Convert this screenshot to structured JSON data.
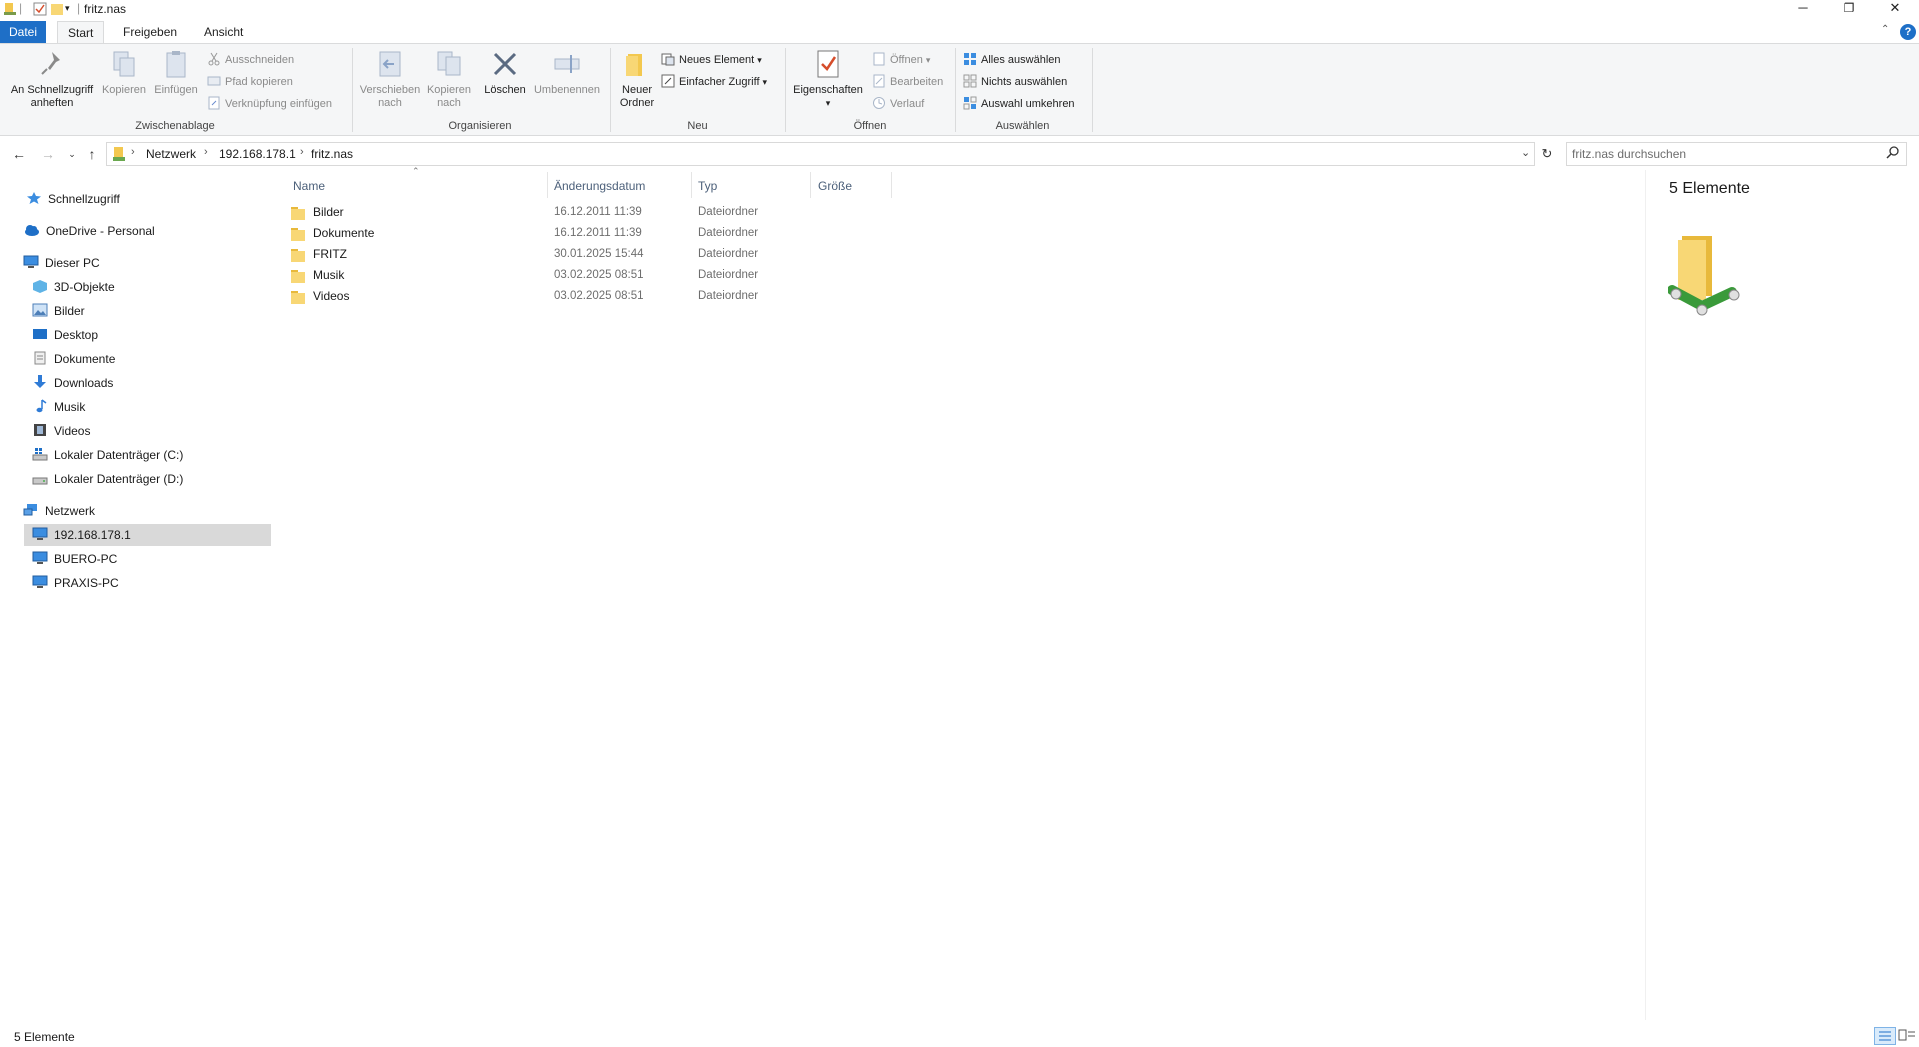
{
  "window": {
    "title": "fritz.nas",
    "controls": {
      "minimize": "─",
      "restore": "❐",
      "close": "✕"
    }
  },
  "ribbon_tabs": [
    "Datei",
    "Start",
    "Freigeben",
    "Ansicht"
  ],
  "ribbon": {
    "zwischenablage": {
      "label": "Zwischenablage",
      "pin": "An Schnellzugriff\nanheften",
      "pin_line1": "An Schnellzugriff",
      "pin_line2": "anheften",
      "copy": "Kopieren",
      "paste": "Einfügen",
      "cut": "Ausschneiden",
      "copy_path": "Pfad kopieren",
      "paste_shortcut": "Verknüpfung einfügen"
    },
    "organisieren": {
      "label": "Organisieren",
      "move_to_line1": "Verschieben",
      "move_to_line2": "nach",
      "copy_to_line1": "Kopieren",
      "copy_to_line2": "nach",
      "delete": "Löschen",
      "rename": "Umbenennen"
    },
    "neu": {
      "label": "Neu",
      "new_folder_line1": "Neuer",
      "new_folder_line2": "Ordner",
      "new_item": "Neues Element",
      "easy_access": "Einfacher Zugriff"
    },
    "oeffnen": {
      "label": "Öffnen",
      "properties": "Eigenschaften",
      "open": "Öffnen",
      "edit": "Bearbeiten",
      "history": "Verlauf"
    },
    "auswaehlen": {
      "label": "Auswählen",
      "select_all": "Alles auswählen",
      "select_none": "Nichts auswählen",
      "invert": "Auswahl umkehren"
    }
  },
  "address": {
    "crumbs": [
      "Netzwerk",
      "192.168.178.1",
      "fritz.nas"
    ],
    "search_placeholder": "fritz.nas durchsuchen"
  },
  "navpane": {
    "quick_access": "Schnellzugriff",
    "onedrive": "OneDrive - Personal",
    "this_pc": "Dieser PC",
    "pc_items": [
      "3D-Objekte",
      "Bilder",
      "Desktop",
      "Dokumente",
      "Downloads",
      "Musik",
      "Videos",
      "Lokaler Datenträger (C:)",
      "Lokaler Datenträger (D:)"
    ],
    "network": "Netzwerk",
    "network_items": [
      "192.168.178.1",
      "BUERO-PC",
      "PRAXIS-PC"
    ],
    "selected": "192.168.178.1"
  },
  "columns": [
    "Name",
    "Änderungsdatum",
    "Typ",
    "Größe"
  ],
  "files": [
    {
      "name": "Bilder",
      "date": "16.12.2011 11:39",
      "type": "Dateiordner",
      "size": ""
    },
    {
      "name": "Dokumente",
      "date": "16.12.2011 11:39",
      "type": "Dateiordner",
      "size": ""
    },
    {
      "name": "FRITZ",
      "date": "30.01.2025 15:44",
      "type": "Dateiordner",
      "size": ""
    },
    {
      "name": "Musik",
      "date": "03.02.2025 08:51",
      "type": "Dateiordner",
      "size": ""
    },
    {
      "name": "Videos",
      "date": "03.02.2025 08:51",
      "type": "Dateiordner",
      "size": ""
    }
  ],
  "preview": {
    "count_label": "5 Elemente"
  },
  "status": {
    "count": "5 Elemente"
  },
  "colors": {
    "accent": "#1e6fc7",
    "folder": "#f8d775",
    "selection": "#d9d9d9"
  }
}
